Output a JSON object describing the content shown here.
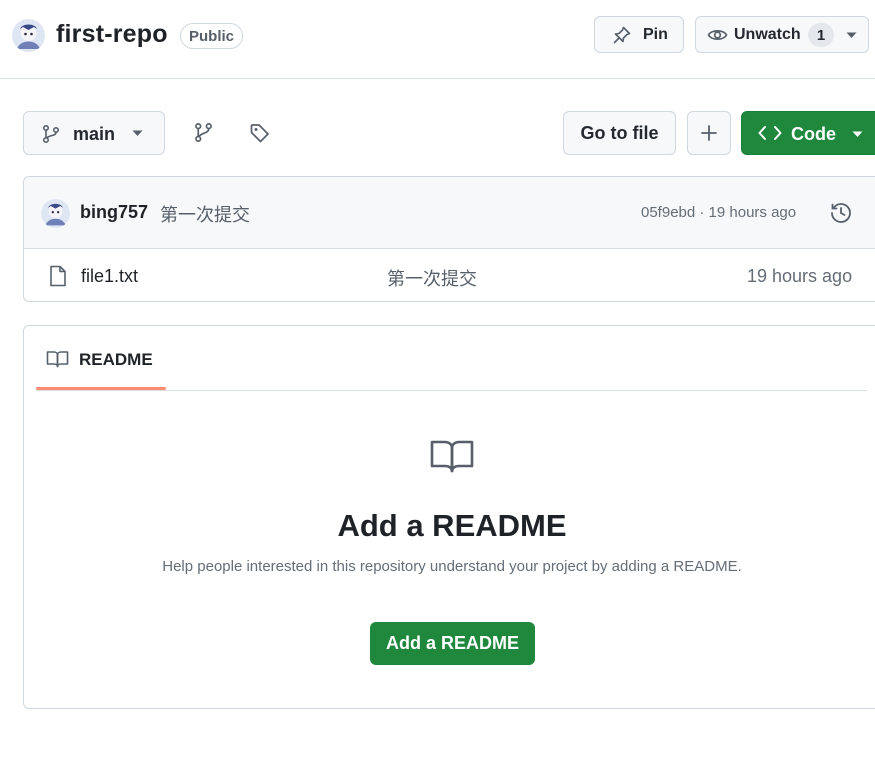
{
  "header": {
    "repo_name": "first-repo",
    "visibility": "Public",
    "pin_label": "Pin",
    "unwatch_label": "Unwatch",
    "watch_count": "1"
  },
  "toolbar": {
    "branch": "main",
    "go_to_file": "Go to file",
    "code_label": "Code"
  },
  "latest_commit": {
    "author": "bing757",
    "message": "第一次提交",
    "meta": "05f9ebd · 19 hours ago"
  },
  "files": [
    {
      "name": "file1.txt",
      "commit_message": "第一次提交",
      "time": "19 hours ago"
    }
  ],
  "readme": {
    "tab_label": "README",
    "title": "Add a README",
    "description": "Help people interested in this repository understand your project by adding a README.",
    "button_label": "Add a README"
  },
  "colors": {
    "primary_green": "#1f883d",
    "tab_underline": "#fd8c73",
    "muted_text": "#656d76"
  },
  "icons": [
    "avatar",
    "pin-icon",
    "eye-icon",
    "caret-down-icon",
    "branch-icon",
    "tag-icon",
    "plus-icon",
    "code-icon",
    "history-icon",
    "file-icon",
    "book-icon"
  ]
}
